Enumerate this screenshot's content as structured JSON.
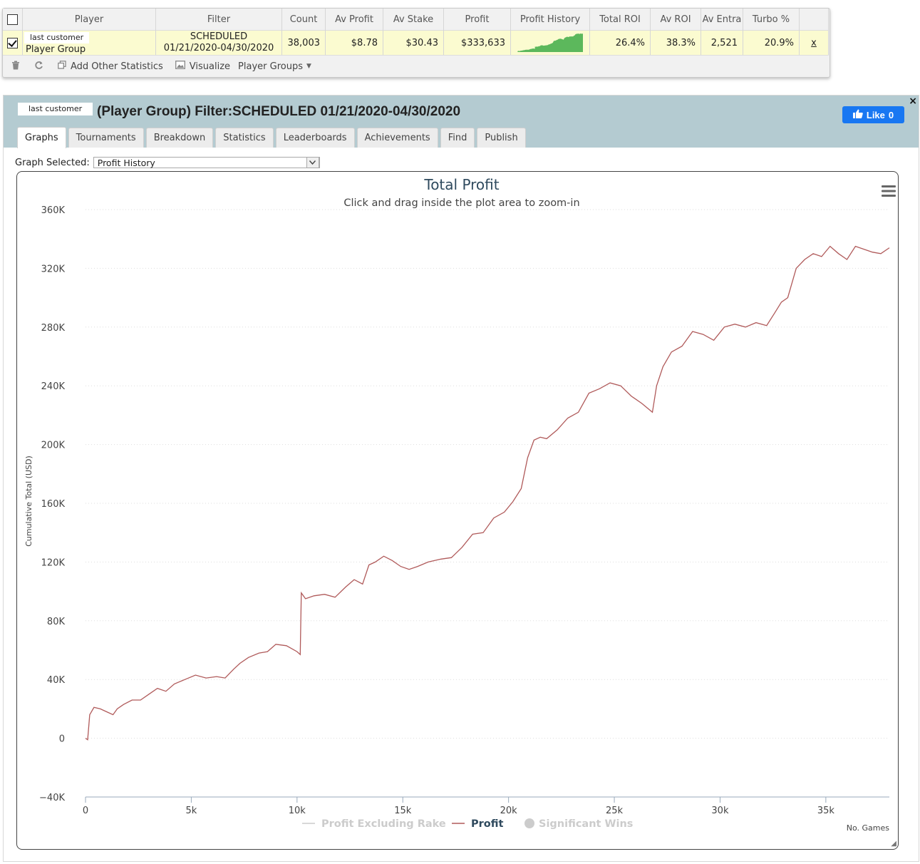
{
  "results_table": {
    "columns": [
      "Player",
      "Filter",
      "Count",
      "Av Profit",
      "Av Stake",
      "Profit",
      "Profit History",
      "Total ROI",
      "Av ROI",
      "Av Entra",
      "Turbo %"
    ],
    "row": {
      "checked": true,
      "player_tag": "last customer",
      "player_name": "Player Group",
      "filter_line1": "SCHEDULED",
      "filter_line2": "01/21/2020-04/30/2020",
      "count": "38,003",
      "av_profit": "$8.78",
      "av_stake": "$30.43",
      "profit": "$333,633",
      "total_roi": "26.4%",
      "av_roi": "38.3%",
      "av_entrants": "2,521",
      "turbo_pct": "20.9%",
      "remove_label": "x"
    },
    "sparkline_color": "#5cb85c"
  },
  "toolbar": {
    "delete_icon": "trash-icon",
    "refresh_icon": "refresh-icon",
    "add_stats_label": "Add Other Statistics",
    "visualize_label": "Visualize",
    "player_groups_label": "Player Groups"
  },
  "panel": {
    "tag": "last customer",
    "title": "(Player Group) Filter:SCHEDULED 01/21/2020-04/30/2020",
    "close_label": "×",
    "like_label": "Like",
    "like_count": "0",
    "tabs": [
      "Graphs",
      "Tournaments",
      "Breakdown",
      "Statistics",
      "Leaderboards",
      "Achievements",
      "Find",
      "Publish"
    ],
    "active_tab": "Graphs",
    "graph_select_label": "Graph Selected:",
    "graph_selected": "Profit History"
  },
  "chart_data": {
    "type": "line",
    "title": "Total Profit",
    "subtitle": "Click and drag inside the plot area to zoom-in",
    "ylabel": "Cumulative Total (USD)",
    "xlabel": "No. Games",
    "ylim": [
      -40000,
      360000
    ],
    "xlim": [
      0,
      38003
    ],
    "y_ticks": [
      "−40K",
      "0",
      "40K",
      "80K",
      "120K",
      "160K",
      "200K",
      "240K",
      "280K",
      "320K",
      "360K"
    ],
    "y_tick_values": [
      -40000,
      0,
      40000,
      80000,
      120000,
      160000,
      200000,
      240000,
      280000,
      320000,
      360000
    ],
    "x_ticks": [
      "0",
      "5k",
      "10k",
      "15k",
      "20k",
      "25k",
      "30k",
      "35k"
    ],
    "x_tick_values": [
      0,
      5000,
      10000,
      15000,
      20000,
      25000,
      30000,
      35000
    ],
    "grid": "horizontal dotted",
    "legend": [
      {
        "name": "Profit Excluding Rake",
        "color": "#cccccc",
        "visible": false
      },
      {
        "name": "Profit",
        "color": "#b05a5a",
        "visible": true
      },
      {
        "name": "Significant Wins",
        "color": "#cccccc",
        "visible": false
      }
    ],
    "series": [
      {
        "name": "Profit",
        "color": "#b05a5a",
        "x": [
          0,
          100,
          200,
          400,
          700,
          1000,
          1300,
          1500,
          1800,
          2200,
          2600,
          3000,
          3400,
          3800,
          4200,
          4700,
          5200,
          5700,
          6200,
          6600,
          7000,
          7300,
          7700,
          8200,
          8600,
          9000,
          9500,
          10000,
          10150,
          10200,
          10400,
          10800,
          11300,
          11800,
          12300,
          12700,
          13100,
          13400,
          13700,
          14100,
          14500,
          14900,
          15300,
          15700,
          16200,
          16800,
          17300,
          17800,
          18300,
          18800,
          19300,
          19800,
          20200,
          20600,
          20900,
          21200,
          21500,
          21800,
          22300,
          22800,
          23300,
          23800,
          24300,
          24800,
          25300,
          25800,
          26300,
          26800,
          27000,
          27300,
          27700,
          28200,
          28700,
          29200,
          29700,
          30200,
          30700,
          31200,
          31700,
          32200,
          32600,
          32900,
          33200,
          33600,
          34000,
          34400,
          34800,
          35200,
          35600,
          36000,
          36400,
          36800,
          37200,
          37600,
          38003
        ],
        "values": [
          0,
          -1000,
          16000,
          21000,
          20000,
          18000,
          16000,
          20000,
          23000,
          26000,
          26000,
          30000,
          34000,
          32000,
          37000,
          40000,
          43000,
          41000,
          42000,
          41000,
          47000,
          51000,
          55000,
          58000,
          59000,
          64000,
          63000,
          59000,
          57000,
          99000,
          95000,
          97000,
          98000,
          96000,
          103000,
          108000,
          105000,
          118000,
          120000,
          124000,
          121000,
          117000,
          115000,
          117000,
          120000,
          122000,
          123000,
          130000,
          139000,
          140000,
          150000,
          154000,
          161000,
          170000,
          191000,
          203000,
          205000,
          204000,
          210000,
          218000,
          222000,
          235000,
          238000,
          242000,
          240000,
          233000,
          228000,
          222000,
          240000,
          253000,
          263000,
          267000,
          277000,
          275000,
          271000,
          280000,
          282000,
          280000,
          283000,
          281000,
          290000,
          297000,
          300000,
          320000,
          326000,
          330000,
          328000,
          335000,
          330000,
          326000,
          335000,
          333000,
          331000,
          330000,
          334000
        ]
      }
    ]
  }
}
